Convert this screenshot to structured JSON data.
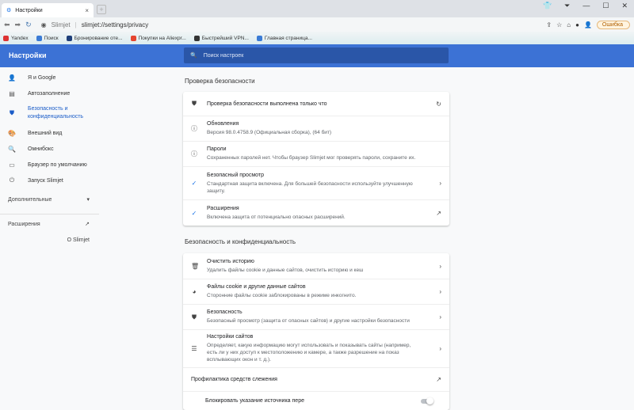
{
  "window": {
    "tab_title": "Настройки",
    "tab_close": "×",
    "new_tab": "+",
    "controls": [
      "⏷",
      "—",
      "☐",
      "✕"
    ]
  },
  "toolbar": {
    "site_name": "Slimjet",
    "url": "slimjet://settings/privacy",
    "error_label": "Ошибка"
  },
  "bookmarks": [
    {
      "label": "Yandex",
      "color": "#d33"
    },
    {
      "label": "Поиск",
      "color": "#3a7bd5"
    },
    {
      "label": "Бронирование оте...",
      "color": "#1f3f7a"
    },
    {
      "label": "Покупки на Aliexpr...",
      "color": "#e5452f"
    },
    {
      "label": "Быстрейший VPN...",
      "color": "#333"
    },
    {
      "label": "Главная страница...",
      "color": "#3a7bd5"
    }
  ],
  "header": {
    "title": "Настройки",
    "search_placeholder": "Поиск настроек"
  },
  "sidebar": {
    "items": [
      {
        "label": "Я и Google",
        "icon": "👤"
      },
      {
        "label": "Автозаполнение",
        "icon": "▤"
      },
      {
        "label": "Безопасность и конфиденциальность",
        "icon": "⛊"
      },
      {
        "label": "Внешний вид",
        "icon": "🎨"
      },
      {
        "label": "Омнибокс",
        "icon": "🔍"
      },
      {
        "label": "Браузер по умолчанию",
        "icon": "▭"
      },
      {
        "label": "Запуск Slimjet",
        "icon": "⏻"
      }
    ],
    "advanced": "Дополнительные",
    "extensions": "Расширения",
    "about": "О Slimjet"
  },
  "safety": {
    "title": "Проверка безопасности",
    "status": "Проверка безопасности выполнена только что",
    "updates_title": "Обновления",
    "updates_desc": "Версия 98.0.4758.9 (Официальная сборка), (64 бит)",
    "passwords_title": "Пароли",
    "passwords_desc": "Сохраненных паролей нет. Чтобы браузер Slimjet мог проверять пароли, сохраните их.",
    "safe_title": "Безопасный просмотр",
    "safe_desc": "Стандартная защита включена. Для большей безопасности используйте улучшенную защиту.",
    "ext_title": "Расширения",
    "ext_desc": "Включена защита от потенциально опасных расширений."
  },
  "privacy": {
    "title": "Безопасность и конфиденциальность",
    "rows": [
      {
        "title": "Очистить историю",
        "desc": "Удалить файлы cookie и данные сайтов, очистить историю и кеш",
        "icon": "🗑"
      },
      {
        "title": "Файлы cookie и другие данные сайтов",
        "desc": "Сторонние файлы cookie заблокированы в режиме инкогнито.",
        "icon": "◕"
      },
      {
        "title": "Безопасность",
        "desc": "Безопасный просмотр (защита от опасных сайтов) и другие настройки безопасности",
        "icon": "⛊"
      },
      {
        "title": "Настройки сайтов",
        "desc": "Определяет, какую информацию могут использовать и показывать сайты (например, есть ли у них доступ к местоположению и камере, а также разрешение на показ всплывающих окон и т. д.).",
        "icon": "☰"
      }
    ],
    "tracking_title": "Профилактика средств слежения",
    "block_referrer": "Блокировать указание источника пере",
    "block_referrer_enabled": false
  }
}
